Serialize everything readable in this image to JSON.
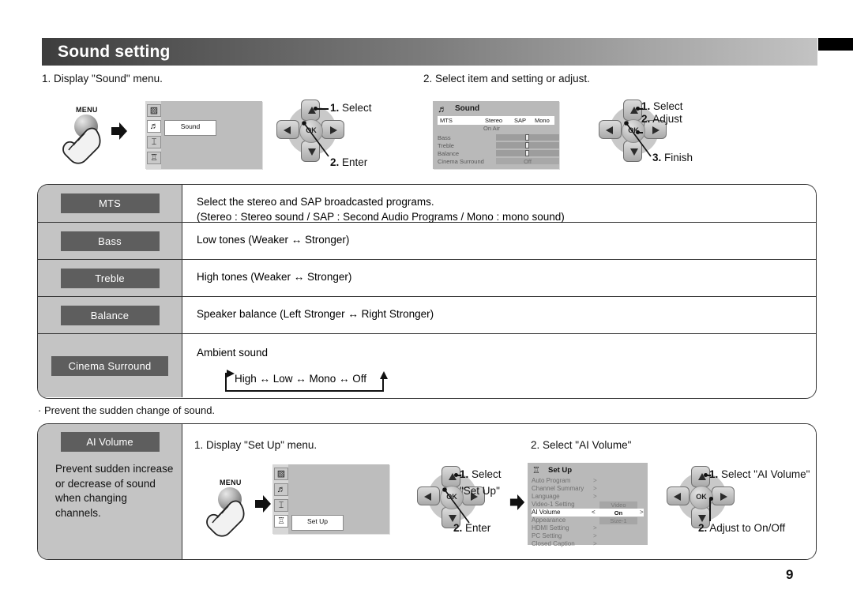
{
  "header": {
    "title": "Sound setting"
  },
  "page_number": "9",
  "steps": {
    "step1_caption": "1. Display \"Sound\" menu.",
    "step2_caption": "2. Select item and setting or adjust."
  },
  "remote": {
    "menu_label": "MENU",
    "ok_label": "OK",
    "menu_icon": "menu-button-icon",
    "hand_icon": "pointing-hand-icon",
    "arrow_icon": "black-right-arrow-icon"
  },
  "callouts": {
    "top_left": [
      {
        "num": "1.",
        "text": "Select"
      },
      {
        "num": "2.",
        "text": "Enter"
      }
    ],
    "top_right": [
      {
        "num": "1.",
        "text": "Select"
      },
      {
        "num": "2.",
        "text": "Adjust"
      },
      {
        "num": "3.",
        "text": "Finish"
      }
    ],
    "bottom_left": [
      {
        "num": "1.",
        "text": "Select"
      },
      {
        "num": "",
        "text": "\"Set Up\""
      },
      {
        "num": "2.",
        "text": "Enter"
      }
    ],
    "bottom_right": [
      {
        "num": "1.",
        "text": "Select \"AI Volume\""
      },
      {
        "num": "2.",
        "text": "Adjust to On/Off"
      }
    ]
  },
  "menu_osd_sound": {
    "icons": [
      "picture-icon",
      "sound-note-icon",
      "clock-icon",
      "setup-icon"
    ],
    "selected_index": 1,
    "flyout_label": "Sound"
  },
  "menu_osd_setup": {
    "icons": [
      "picture-icon",
      "sound-note-icon",
      "clock-icon",
      "setup-icon"
    ],
    "selected_index": 3,
    "flyout_label": "Set Up"
  },
  "sound_osd": {
    "title": "Sound",
    "icon": "sound-note-icon",
    "mts_label": "MTS",
    "mts_options": [
      "Stereo",
      "SAP",
      "Mono"
    ],
    "on_air": "On Air",
    "rows": [
      {
        "label": "Bass",
        "type": "slider"
      },
      {
        "label": "Treble",
        "type": "slider"
      },
      {
        "label": "Balance",
        "type": "slider"
      },
      {
        "label": "Cinema Surround",
        "type": "value",
        "value": "Off"
      }
    ]
  },
  "setup_osd": {
    "title": "Set Up",
    "icon": "setup-icon",
    "rows": [
      {
        "label": "Auto Program",
        "arrow": ">",
        "value": ""
      },
      {
        "label": "Channel Summary",
        "arrow": ">",
        "value": ""
      },
      {
        "label": "Language",
        "arrow": ">",
        "value": ""
      },
      {
        "label": "Video-1 Setting",
        "arrow": "",
        "value": "Video"
      },
      {
        "label": "AI Volume",
        "arrow": "",
        "value": "On",
        "highlighted": true,
        "left_caret": "<",
        "right_caret": ">"
      },
      {
        "label": "Appearance",
        "arrow": "",
        "value": "Size-1"
      },
      {
        "label": "HDMI Setting",
        "arrow": ">",
        "value": ""
      },
      {
        "label": "PC Setting",
        "arrow": ">",
        "value": ""
      },
      {
        "label": "Closed Caption",
        "arrow": ">",
        "value": ""
      }
    ]
  },
  "spec_table": {
    "rows": [
      {
        "name": "MTS",
        "desc_line1": "Select the stereo and SAP broadcasted programs.",
        "desc_line2": "(Stereo : Stereo sound / SAP : Second Audio Programs / Mono : mono sound)"
      },
      {
        "name": "Bass",
        "desc_line1": "Low tones (Weaker ↔ Stronger)",
        "desc_line2": ""
      },
      {
        "name": "Treble",
        "desc_line1": "High tones (Weaker ↔ Stronger)",
        "desc_line2": ""
      },
      {
        "name": "Balance",
        "desc_line1": "Speaker balance (Left Stronger ↔ Right Stronger)",
        "desc_line2": ""
      },
      {
        "name": "Cinema Surround",
        "desc_line1": "Ambient sound",
        "cycle": "High ↔ Low ↔ Mono ↔ Off"
      }
    ]
  },
  "note": "· Prevent the sudden change of sound.",
  "ai_volume": {
    "badge": "AI Volume",
    "description": "Prevent sudden increase or decrease of sound when changing channels.",
    "step1_caption": "1. Display \"Set Up\" menu.",
    "step2_caption": "2. Select \"AI Volume\""
  }
}
